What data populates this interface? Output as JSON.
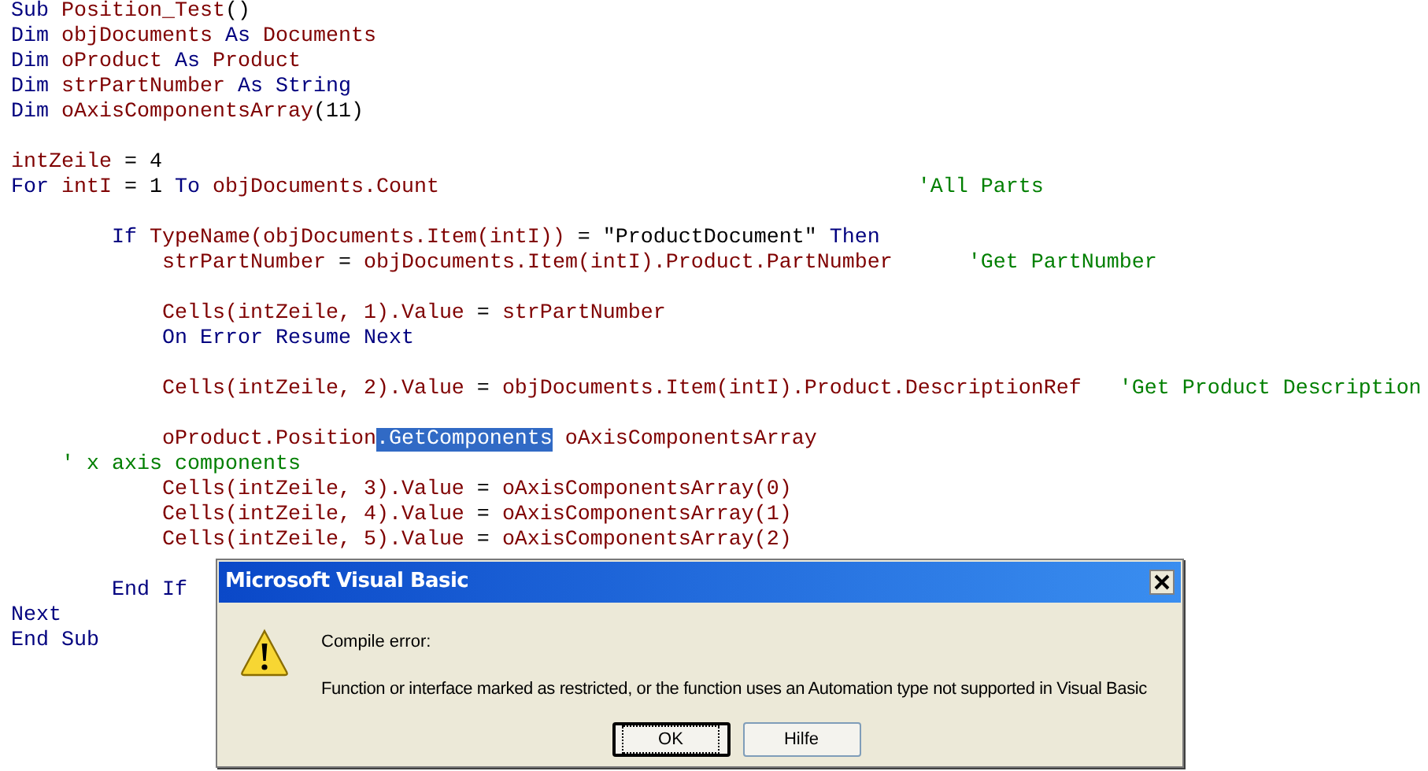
{
  "code": {
    "lines": [
      {
        "kind": "code",
        "tokens": [
          {
            "text": "Sub",
            "kind": "keyword"
          },
          {
            "text": " Position_Test",
            "kind": "ident"
          },
          {
            "text": "()",
            "kind": "plain"
          }
        ]
      },
      {
        "kind": "code",
        "tokens": [
          {
            "text": "Dim",
            "kind": "keyword"
          },
          {
            "text": " objDocuments",
            "kind": "ident"
          },
          {
            "text": " As",
            "kind": "keyword"
          },
          {
            "text": " Documents",
            "kind": "ident"
          }
        ]
      },
      {
        "kind": "code",
        "tokens": [
          {
            "text": "Dim",
            "kind": "keyword"
          },
          {
            "text": " oProduct",
            "kind": "ident"
          },
          {
            "text": " As",
            "kind": "keyword"
          },
          {
            "text": " Product",
            "kind": "ident"
          }
        ]
      },
      {
        "kind": "code",
        "tokens": [
          {
            "text": "Dim",
            "kind": "keyword"
          },
          {
            "text": " strPartNumber",
            "kind": "ident"
          },
          {
            "text": " As String",
            "kind": "keyword"
          }
        ]
      },
      {
        "kind": "code",
        "tokens": [
          {
            "text": "Dim",
            "kind": "keyword"
          },
          {
            "text": " oAxisComponentsArray",
            "kind": "ident"
          },
          {
            "text": "(11)",
            "kind": "plain"
          }
        ]
      },
      {
        "kind": "blank"
      },
      {
        "kind": "code",
        "tokens": [
          {
            "text": "intZeile",
            "kind": "ident"
          },
          {
            "text": " = 4",
            "kind": "plain"
          }
        ]
      },
      {
        "kind": "code",
        "tokens": [
          {
            "text": "For",
            "kind": "keyword"
          },
          {
            "text": " intI",
            "kind": "ident"
          },
          {
            "text": " = 1",
            "kind": "plain"
          },
          {
            "text": " To",
            "kind": "keyword"
          },
          {
            "text": " objDocuments.Count",
            "kind": "ident"
          },
          {
            "text": "                                      'All Parts",
            "kind": "comment"
          }
        ]
      },
      {
        "kind": "blank"
      },
      {
        "kind": "code",
        "tokens": [
          {
            "text": "        If",
            "kind": "keyword"
          },
          {
            "text": " TypeName(objDocuments.Item(intI))",
            "kind": "ident"
          },
          {
            "text": " = \"ProductDocument\"",
            "kind": "plain"
          },
          {
            "text": " Then",
            "kind": "keyword"
          }
        ]
      },
      {
        "kind": "code",
        "tokens": [
          {
            "text": "            strPartNumber",
            "kind": "ident"
          },
          {
            "text": " = ",
            "kind": "plain"
          },
          {
            "text": "objDocuments.Item(intI).Product.PartNumber",
            "kind": "ident"
          },
          {
            "text": "      'Get PartNumber",
            "kind": "comment"
          }
        ]
      },
      {
        "kind": "blank"
      },
      {
        "kind": "code",
        "tokens": [
          {
            "text": "            Cells(intZeile, 1).Value",
            "kind": "ident"
          },
          {
            "text": " = ",
            "kind": "plain"
          },
          {
            "text": "strPartNumber",
            "kind": "ident"
          }
        ]
      },
      {
        "kind": "code",
        "tokens": [
          {
            "text": "            On Error Resume Next",
            "kind": "keyword"
          }
        ]
      },
      {
        "kind": "blank"
      },
      {
        "kind": "code",
        "tokens": [
          {
            "text": "            Cells(intZeile, 2).Value",
            "kind": "ident"
          },
          {
            "text": " = ",
            "kind": "plain"
          },
          {
            "text": "objDocuments.Item(intI).Product.DescriptionRef",
            "kind": "ident"
          },
          {
            "text": "   'Get Product Description",
            "kind": "comment"
          }
        ]
      },
      {
        "kind": "blank"
      },
      {
        "kind": "code",
        "tokens": [
          {
            "text": "            oProduct.Position",
            "kind": "ident"
          },
          {
            "text": ".GetComponents",
            "kind": "selected"
          },
          {
            "text": " oAxisComponentsArray",
            "kind": "ident"
          }
        ]
      },
      {
        "kind": "code",
        "tokens": [
          {
            "text": "    ' x axis components",
            "kind": "comment"
          }
        ]
      },
      {
        "kind": "code",
        "tokens": [
          {
            "text": "            Cells(intZeile, 3).Value",
            "kind": "ident"
          },
          {
            "text": " = ",
            "kind": "plain"
          },
          {
            "text": "oAxisComponentsArray(0)",
            "kind": "ident"
          }
        ]
      },
      {
        "kind": "code",
        "tokens": [
          {
            "text": "            Cells(intZeile, 4).Value",
            "kind": "ident"
          },
          {
            "text": " = ",
            "kind": "plain"
          },
          {
            "text": "oAxisComponentsArray(1)",
            "kind": "ident"
          }
        ]
      },
      {
        "kind": "code",
        "tokens": [
          {
            "text": "            Cells(intZeile, 5).Value",
            "kind": "ident"
          },
          {
            "text": " = ",
            "kind": "plain"
          },
          {
            "text": "oAxisComponentsArray(2)",
            "kind": "ident"
          }
        ]
      },
      {
        "kind": "blank"
      },
      {
        "kind": "code",
        "tokens": [
          {
            "text": "        End If",
            "kind": "keyword"
          }
        ]
      },
      {
        "kind": "code",
        "tokens": [
          {
            "text": "Next",
            "kind": "keyword"
          }
        ]
      },
      {
        "kind": "code",
        "tokens": [
          {
            "text": "End Sub",
            "kind": "keyword"
          }
        ]
      }
    ]
  },
  "dialog": {
    "title": "Microsoft Visual Basic",
    "heading": "Compile error:",
    "message": "Function or interface marked as restricted, or the function uses an Automation type not supported in Visual Basic",
    "buttons": [
      {
        "label": "OK",
        "focused": true
      },
      {
        "label": "Hilfe",
        "focused": false
      }
    ]
  }
}
